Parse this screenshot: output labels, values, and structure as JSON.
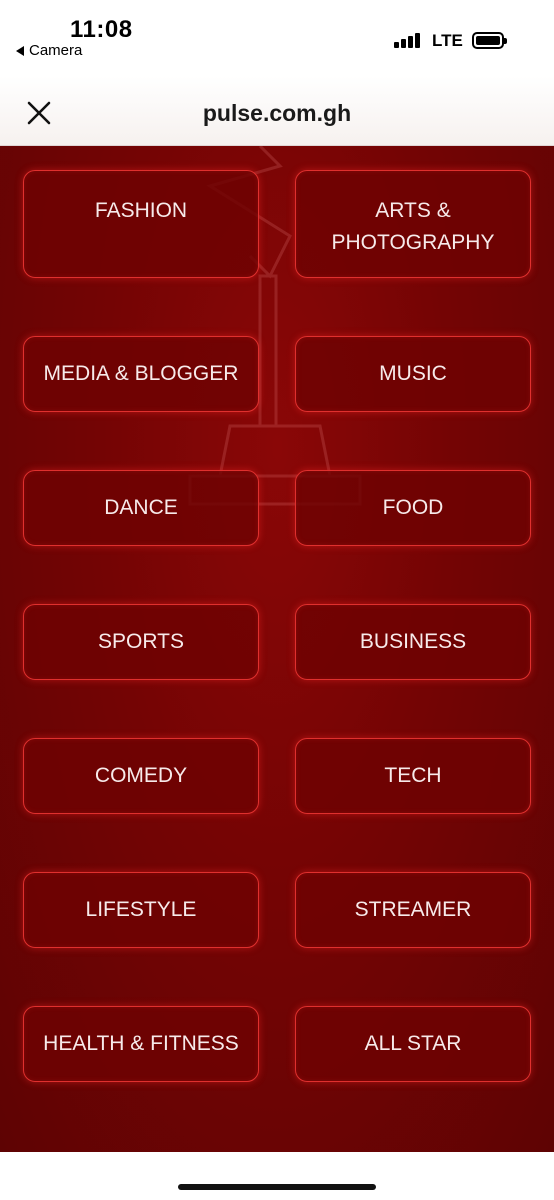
{
  "status_bar": {
    "time": "11:08",
    "back_app": "Camera",
    "network": "LTE"
  },
  "header": {
    "title": "pulse.com.gh",
    "close_icon": "close-icon"
  },
  "categories": [
    [
      "FASHION",
      "ARTS & PHOTOGRAPHY"
    ],
    [
      "MEDIA & BLOGGER",
      "MUSIC"
    ],
    [
      "DANCE",
      "FOOD"
    ],
    [
      "SPORTS",
      "BUSINESS"
    ],
    [
      "COMEDY",
      "TECH"
    ],
    [
      "LIFESTYLE",
      "STREAMER"
    ],
    [
      "HEALTH & FITNESS",
      "ALL STAR"
    ]
  ],
  "colors": {
    "background": "#740404",
    "button_border": "#e0302e",
    "button_text": "#f7eaea"
  }
}
